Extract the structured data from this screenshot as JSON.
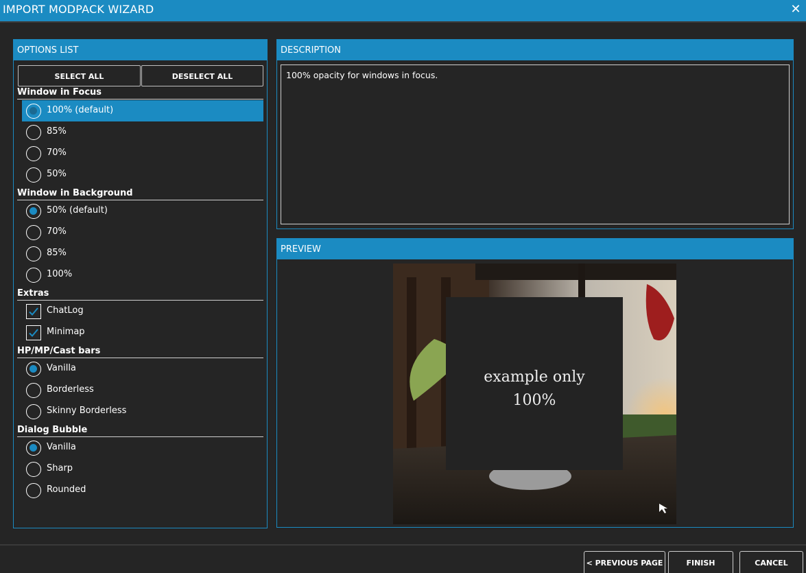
{
  "window": {
    "title": "IMPORT MODPACK WIZARD",
    "close_glyph": "✕"
  },
  "options_panel": {
    "header": "OPTIONS LIST",
    "select_all": "SELECT ALL",
    "deselect_all": "DESELECT ALL",
    "groups": [
      {
        "title": "Window in Focus",
        "type": "radio",
        "options": [
          {
            "label": "100% (default)",
            "selected": true,
            "highlighted": true
          },
          {
            "label": "85%",
            "selected": false
          },
          {
            "label": "70%",
            "selected": false
          },
          {
            "label": "50%",
            "selected": false
          }
        ]
      },
      {
        "title": "Window in Background",
        "type": "radio",
        "options": [
          {
            "label": "50% (default)",
            "selected": true
          },
          {
            "label": "70%",
            "selected": false
          },
          {
            "label": "85%",
            "selected": false
          },
          {
            "label": "100%",
            "selected": false
          }
        ]
      },
      {
        "title": "Extras",
        "type": "checkbox",
        "options": [
          {
            "label": "ChatLog",
            "checked": true
          },
          {
            "label": "Minimap",
            "checked": true
          }
        ]
      },
      {
        "title": "HP/MP/Cast bars",
        "type": "radio",
        "options": [
          {
            "label": "Vanilla",
            "selected": true
          },
          {
            "label": "Borderless",
            "selected": false
          },
          {
            "label": "Skinny Borderless",
            "selected": false
          }
        ]
      },
      {
        "title": "Dialog Bubble",
        "type": "radio",
        "options": [
          {
            "label": "Vanilla",
            "selected": true
          },
          {
            "label": "Sharp",
            "selected": false
          },
          {
            "label": "Rounded",
            "selected": false
          }
        ]
      }
    ]
  },
  "description_panel": {
    "header": "DESCRIPTION",
    "text": "100% opacity for windows in focus."
  },
  "preview_panel": {
    "header": "PREVIEW",
    "overlay_line1": "example only",
    "overlay_line2": "100%"
  },
  "footer": {
    "previous": "< PREVIOUS PAGE",
    "finish": "FINISH",
    "cancel": "CANCEL"
  },
  "colors": {
    "accent": "#1b8bc2",
    "background": "#252525"
  }
}
